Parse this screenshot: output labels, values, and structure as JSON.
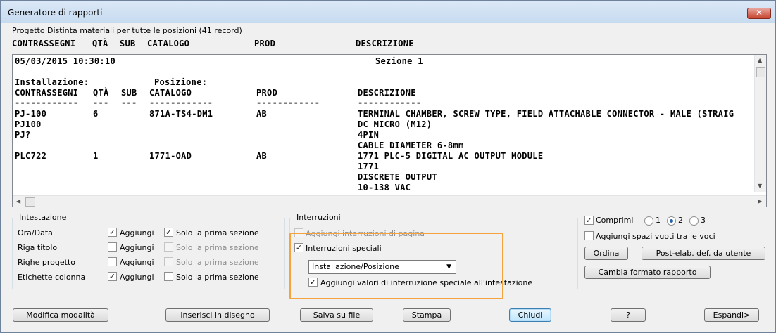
{
  "window": {
    "title": "Generatore di rapporti",
    "close_label": "✕"
  },
  "info_line": "Progetto Distinta materiali per tutte le posizioni (41 record)",
  "column_headers": {
    "tags": "CONTRASSEGNI",
    "qty": "QTÀ",
    "sub": "SUB",
    "catalog": "CATALOGO",
    "prod": "PROD",
    "description": "DESCRIZIONE"
  },
  "report": {
    "timestamp": "05/03/2015 10:30:10",
    "section": "Sezione 1",
    "install_label": "Installazione:",
    "location_label": "Posizione:",
    "headers": {
      "tags": "CONTRASSEGNI",
      "qty": "QTÀ",
      "sub": "SUB",
      "catalog": "CATALOGO",
      "prod": "PROD",
      "description": "DESCRIZIONE"
    },
    "underlines": {
      "tags": "------------",
      "qty": "---",
      "sub": "---",
      "catalog": "------------",
      "prod": "------------",
      "description": "------------"
    },
    "rows": [
      {
        "tags": [
          "PJ-100",
          "PJ100",
          "PJ?"
        ],
        "qty": "6",
        "catalog": "871A-TS4-DM1",
        "prod": "AB",
        "description": [
          "TERMINAL CHAMBER, SCREW TYPE, FIELD ATTACHABLE CONNECTOR - MALE (STRAIG",
          "DC MICRO (M12)",
          "4PIN",
          "CABLE DIAMETER 6-8mm"
        ]
      },
      {
        "tags": [
          "PLC722"
        ],
        "qty": "1",
        "catalog": "1771-OAD",
        "prod": "AB",
        "description": [
          "1771 PLC-5 DIGITAL AC OUTPUT MODULE",
          "1771",
          "DISCRETE OUTPUT",
          "10-138 VAC"
        ]
      }
    ]
  },
  "header_group": {
    "title": "Intestazione",
    "rows": [
      {
        "label": "Ora/Data",
        "add": "Aggiungi",
        "add_checked": true,
        "first": "Solo la prima sezione",
        "first_checked": true,
        "first_enabled": true
      },
      {
        "label": "Riga titolo",
        "add": "Aggiungi",
        "add_checked": false,
        "first": "Solo la prima sezione",
        "first_checked": false,
        "first_enabled": false
      },
      {
        "label": "Righe progetto",
        "add": "Aggiungi",
        "add_checked": false,
        "first": "Solo la prima sezione",
        "first_checked": false,
        "first_enabled": false
      },
      {
        "label": "Etichette colonna",
        "add": "Aggiungi",
        "add_checked": true,
        "first": "Solo la prima sezione",
        "first_checked": false,
        "first_enabled": true
      }
    ]
  },
  "breaks_group": {
    "title": "Interruzioni",
    "page_breaks": "Aggiungi interruzioni di pagina",
    "special_breaks": "Interruzioni speciali",
    "dropdown_value": "Installazione/Posizione",
    "add_to_header": "Aggiungi valori di interruzione speciale all'intestazione"
  },
  "options": {
    "compress": "Comprimi",
    "radios": [
      "1",
      "2",
      "3"
    ],
    "selected_radio": "2",
    "blank_lines": "Aggiungi spazi vuoti tra le voci",
    "sort": "Ordina",
    "user_post": "Post-elab. def. da utente",
    "change_format": "Cambia formato rapporto"
  },
  "buttons": {
    "edit_mode": "Modifica modalità",
    "insert": "Inserisci in disegno",
    "save": "Salva su file",
    "print": "Stampa",
    "close": "Chiudi",
    "help": "?",
    "expand": "Espandi>"
  },
  "checkmark": "✓",
  "colors": {
    "highlight": "#f4a33f",
    "accent": "#2563a8"
  }
}
